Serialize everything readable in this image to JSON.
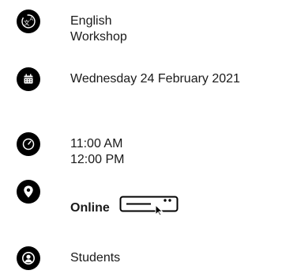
{
  "event": {
    "language": {
      "icon": "translate-icon",
      "line1": "English",
      "line2": "Workshop"
    },
    "date": {
      "icon": "calendar-icon",
      "text": "Wednesday 24 February 2021"
    },
    "time": {
      "icon": "clock-icon",
      "start": "11:00 AM",
      "end": "12:00 PM"
    },
    "location": {
      "icon": "location-pin-icon",
      "text": "Online",
      "device_icon": "online-device-icon"
    },
    "audience": {
      "icon": "user-icon",
      "text": "Students"
    }
  }
}
